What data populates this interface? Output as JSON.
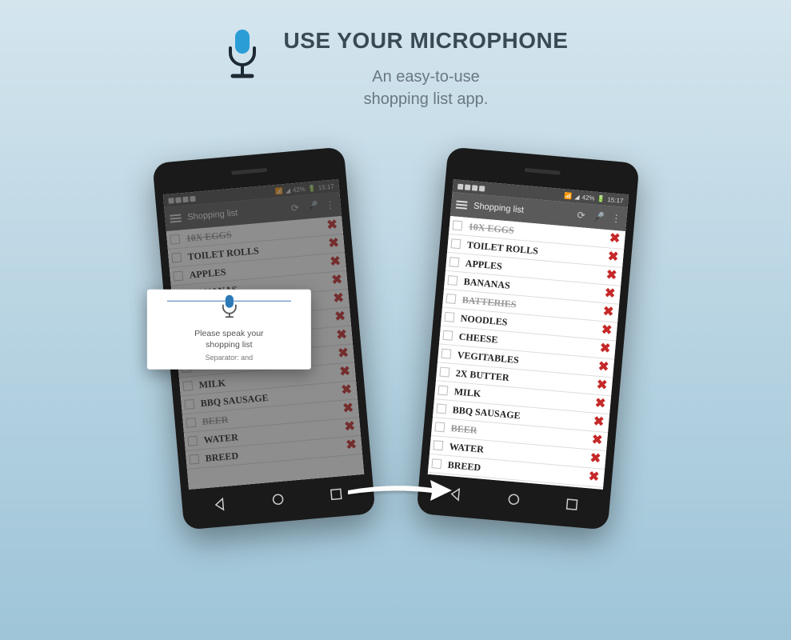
{
  "header": {
    "title": "USE YOUR MICROPHONE",
    "subtitle_line1": "An easy-to-use",
    "subtitle_line2": "shopping list app."
  },
  "status": {
    "signal": "42%",
    "time": "15:17"
  },
  "app": {
    "title": "Shopping list"
  },
  "voice_popup": {
    "line1": "Please speak your",
    "line2": "shopping list",
    "separator": "Separator: and"
  },
  "left_list": [
    {
      "text": "10X EGGS",
      "done": true
    },
    {
      "text": "TOILET ROLLS",
      "done": false
    },
    {
      "text": "APPLES",
      "done": false
    },
    {
      "text": "BANANAS",
      "done": false
    },
    {
      "text": "",
      "done": false
    },
    {
      "text": "",
      "done": false
    },
    {
      "text": "",
      "done": false
    },
    {
      "text": "",
      "done": false
    },
    {
      "text": "MILK",
      "done": false
    },
    {
      "text": "BBQ SAUSAGE",
      "done": false
    },
    {
      "text": "BEER",
      "done": true
    },
    {
      "text": "WATER",
      "done": false
    },
    {
      "text": "BREED",
      "done": false
    }
  ],
  "right_list": [
    {
      "text": "10X EGGS",
      "done": true
    },
    {
      "text": "TOILET ROLLS",
      "done": false
    },
    {
      "text": "APPLES",
      "done": false
    },
    {
      "text": "BANANAS",
      "done": false
    },
    {
      "text": "BATTERIES",
      "done": true
    },
    {
      "text": "NOODLES",
      "done": false
    },
    {
      "text": "CHEESE",
      "done": false
    },
    {
      "text": "VEGITABLES",
      "done": false
    },
    {
      "text": "2X BUTTER",
      "done": false
    },
    {
      "text": "MILK",
      "done": false
    },
    {
      "text": "BBQ SAUSAGE",
      "done": false
    },
    {
      "text": "BEER",
      "done": true
    },
    {
      "text": "WATER",
      "done": false
    },
    {
      "text": "BREED",
      "done": false
    }
  ]
}
